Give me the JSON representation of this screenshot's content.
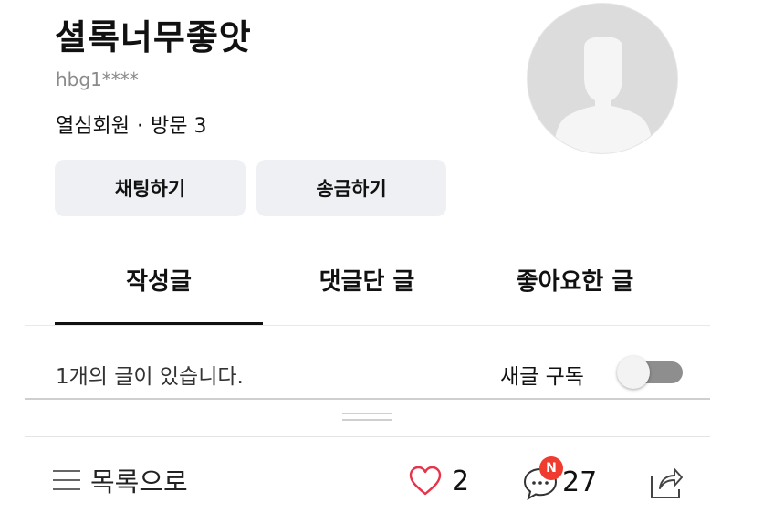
{
  "profile": {
    "name": "셜록너무좋앗",
    "user_id": "hbg1****",
    "member_level": "열심회원",
    "separator": "·",
    "visits_label": "방문",
    "visits_count": "3"
  },
  "actions": {
    "chat_label": "채팅하기",
    "send_money_label": "송금하기"
  },
  "tabs": [
    {
      "label": "작성글",
      "active": true
    },
    {
      "label": "댓글단 글",
      "active": false
    },
    {
      "label": "좋아요한 글",
      "active": false
    }
  ],
  "content": {
    "post_count_text": "1개의 글이 있습니다.",
    "subscribe_label": "새글 구독",
    "subscribe_on": false
  },
  "bottom_bar": {
    "list_label": "목록으로",
    "like_count": "2",
    "new_badge": "N",
    "comment_count": "27"
  },
  "colors": {
    "badge": "#f03c2e",
    "heart": "#e8334a",
    "button_bg": "#eef0f3",
    "toggle_track": "#8e8e8e"
  },
  "icons": [
    "list-icon",
    "heart-icon",
    "comment-icon",
    "share-icon",
    "avatar-placeholder-icon"
  ]
}
